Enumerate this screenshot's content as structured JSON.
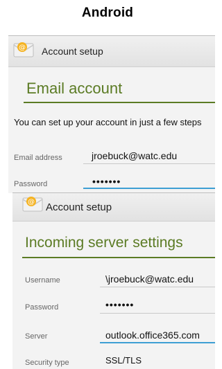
{
  "page_title": "Android",
  "screen1": {
    "actionbar_title": "Account setup",
    "heading": "Email account",
    "intro": "You can set up your account in just a few steps",
    "fields": [
      {
        "label": "Email address",
        "value": "jroebuck@watc.edu"
      },
      {
        "label": "Password",
        "value": "•••••••"
      }
    ]
  },
  "screen2": {
    "actionbar_title": "Account setup",
    "heading": "Incoming server settings",
    "fields": [
      {
        "label": "Username",
        "value": "\\jroebuck@watc.edu"
      },
      {
        "label": "Password",
        "value": "•••••••"
      },
      {
        "label": "Server",
        "value": "outlook.office365.com"
      },
      {
        "label": "Security type",
        "value": "SSL/TLS"
      }
    ]
  },
  "colors": {
    "heading_green": "#5b7b24",
    "focus_blue": "#3d9fd3"
  },
  "icons": {
    "app": "email-envelope-icon"
  }
}
